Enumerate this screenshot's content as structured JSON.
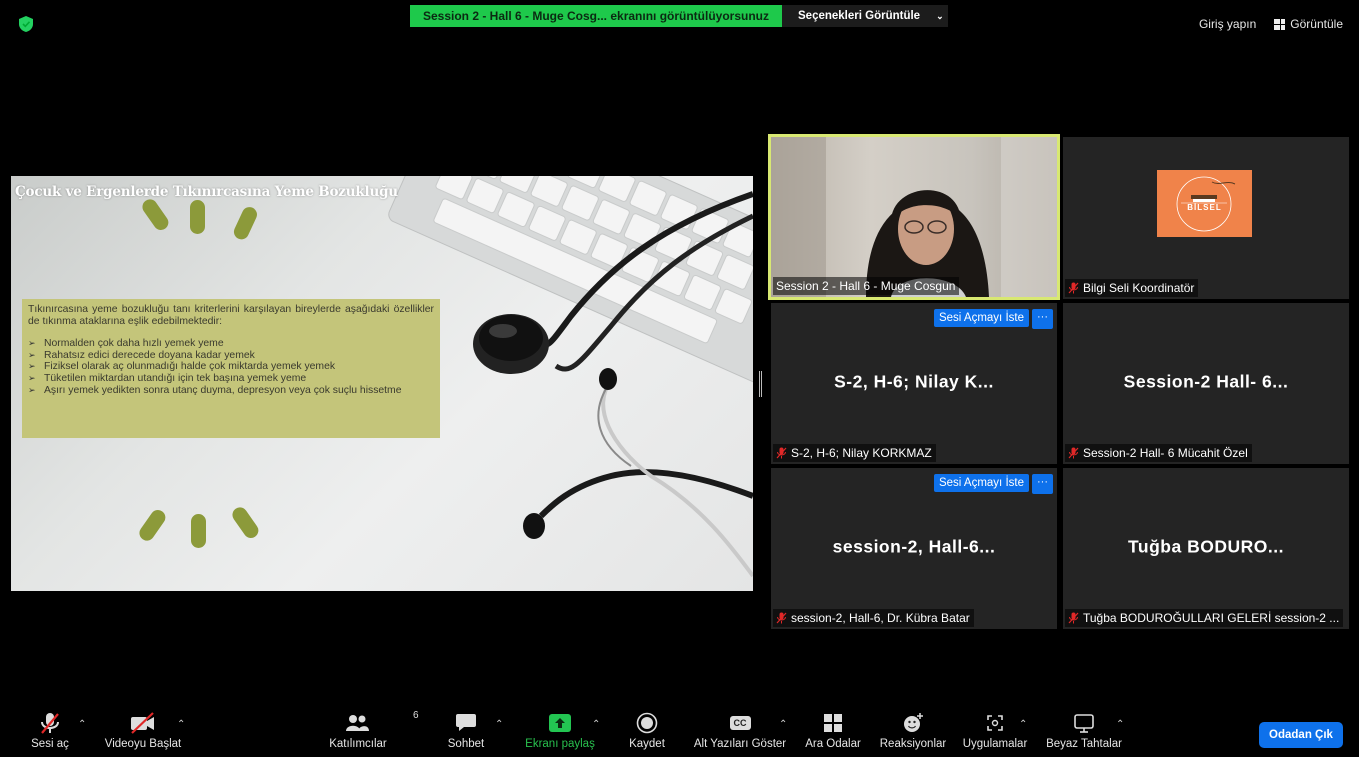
{
  "topbar": {
    "share_banner": "Session 2 - Hall 6 - Muge Cosg... ekranını görüntülüyorsunuz",
    "view_options": "Seçenekleri Görüntüle",
    "sign_in": "Giriş yapın",
    "view": "Görüntüle"
  },
  "slide": {
    "title": "Çocuk ve Ergenlerde Tıkınırcasına Yeme Bozukluğu",
    "intro": "Tıkınırcasına yeme bozukluğu tanı kriterlerini karşılayan bireylerde aşağıdaki özellikler de tıkınma ataklarına eşlik edebilmektedir:",
    "bullets": [
      "Normalden çok daha hızlı yemek yeme",
      "Rahatsız edici derecede doyana kadar yemek",
      "Fiziksel olarak aç olunmadığı halde çok miktarda yemek yemek",
      "Tüketilen miktardan utandığı için tek başına yemek yeme",
      "Aşırı yemek yedikten sonra utanç duyma, depresyon veya çok suçlu hissetme"
    ]
  },
  "tiles": {
    "speaker": {
      "name": "Session 2 - Hall 6 - Muge Cosgun"
    },
    "coordinator": {
      "name": "Bilgi Seli Koordinatör",
      "logo_text": "BİLSEL"
    },
    "t3": {
      "big": "S-2, H-6; Nilay K...",
      "name": "S-2, H-6; Nilay KORKMAZ",
      "ask": "Sesi Açmayı İste",
      "more": "···"
    },
    "t4": {
      "big": "Session-2 Hall- 6...",
      "name": "Session-2 Hall- 6 Mücahit Özel"
    },
    "t5": {
      "big": "session-2,  Hall-6...",
      "name": "session-2, Hall-6, Dr. Kübra Batar",
      "ask": "Sesi Açmayı İste",
      "more": "···"
    },
    "t6": {
      "big": "Tuğba  BODURO...",
      "name": "Tuğba BODUROĞULLARI GELERİ session-2 ..."
    }
  },
  "toolbar": {
    "unmute": "Sesi aç",
    "start_video": "Videoyu Başlat",
    "participants": "Katılımcılar",
    "participants_count": "6",
    "chat": "Sohbet",
    "share_screen": "Ekranı paylaş",
    "record": "Kaydet",
    "captions": "Alt Yazıları Göster",
    "captions_icon_text": "CC",
    "breakout": "Ara Odalar",
    "reactions": "Reaksiyonlar",
    "apps": "Uygulamalar",
    "whiteboards": "Beyaz Tahtalar",
    "leave": "Odadan Çık"
  },
  "colors": {
    "accent_blue": "#0e71eb",
    "share_green": "#1ec94b",
    "slide_box": "#c4c57a",
    "active_border": "#d8e872",
    "logo_orange": "#f0834a"
  }
}
